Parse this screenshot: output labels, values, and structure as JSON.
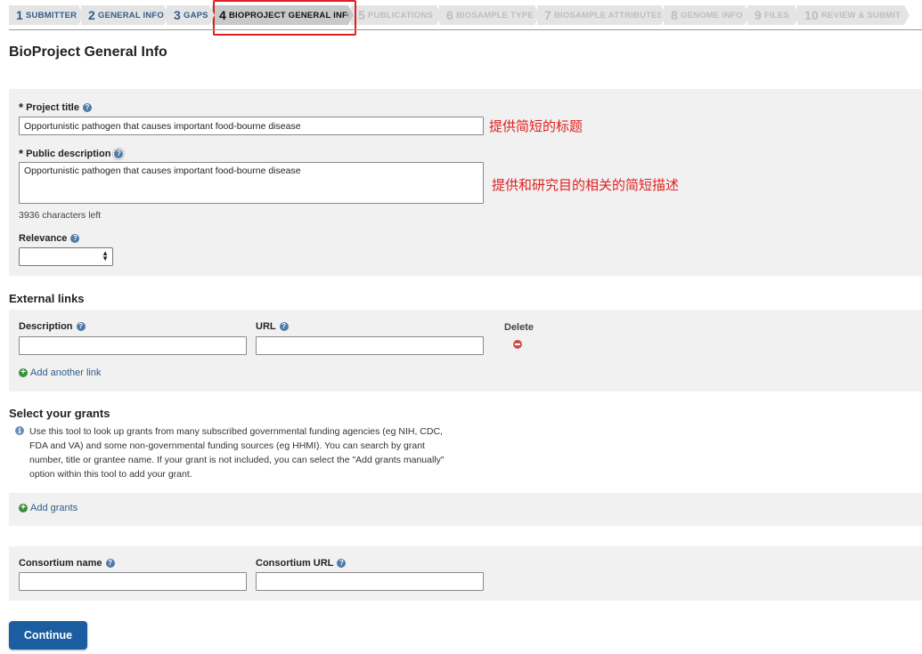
{
  "steps": [
    {
      "num": "1",
      "label": "SUBMITTER",
      "state": "done"
    },
    {
      "num": "2",
      "label": "GENERAL INFO",
      "state": "done"
    },
    {
      "num": "3",
      "label": "GAPS",
      "state": "done"
    },
    {
      "num": "4",
      "label": "BIOPROJECT GENERAL INFO",
      "state": "active"
    },
    {
      "num": "5",
      "label": "PUBLICATIONS",
      "state": "todo"
    },
    {
      "num": "6",
      "label": "BIOSAMPLE TYPE",
      "state": "todo"
    },
    {
      "num": "7",
      "label": "BIOSAMPLE ATTRIBUTES",
      "state": "todo"
    },
    {
      "num": "8",
      "label": "GENOME INFO",
      "state": "todo"
    },
    {
      "num": "9",
      "label": "FILES",
      "state": "todo"
    },
    {
      "num": "10",
      "label": "REVIEW & SUBMIT",
      "state": "todo"
    }
  ],
  "page_title": "BioProject General Info",
  "general": {
    "required_mark": "*",
    "project_title_label": "Project title",
    "project_title_value": "Opportunistic pathogen that causes important food-bourne disease",
    "project_title_note": "提供简短的标题",
    "public_description_label": "Public description",
    "public_description_value": "Opportunistic pathogen that causes important food-bourne disease",
    "public_description_note": "提供和研究目的相关的简短描述",
    "chars_left": "3936 characters left",
    "relevance_label": "Relevance",
    "relevance_value": ""
  },
  "external_links": {
    "title": "External links",
    "description_label": "Description",
    "url_label": "URL",
    "delete_label": "Delete",
    "description_value": "",
    "url_value": "",
    "add_link": "Add another link"
  },
  "grants": {
    "title": "Select your grants",
    "info_lines": [
      "Use this tool to look up grants from many subscribed governmental funding agencies (eg NIH, CDC,",
      "FDA and VA) and some non-governmental funding sources (eg HHMI). You can search by grant",
      "number, title or grantee name. If your grant is not included, you can select the \"Add grants manually\"",
      "option within this tool to add your grant."
    ],
    "add_grants": "Add grants"
  },
  "consortium": {
    "name_label": "Consortium name",
    "url_label": "Consortium URL",
    "name_value": "",
    "url_value": ""
  },
  "continue_label": "Continue",
  "icons": {
    "help": "?",
    "plus": "+",
    "info": "i"
  },
  "colors": {
    "accent": "#1a5ea1",
    "annotation": "#e02020",
    "link": "#2f5d8a",
    "panel": "#f1f1f1"
  }
}
